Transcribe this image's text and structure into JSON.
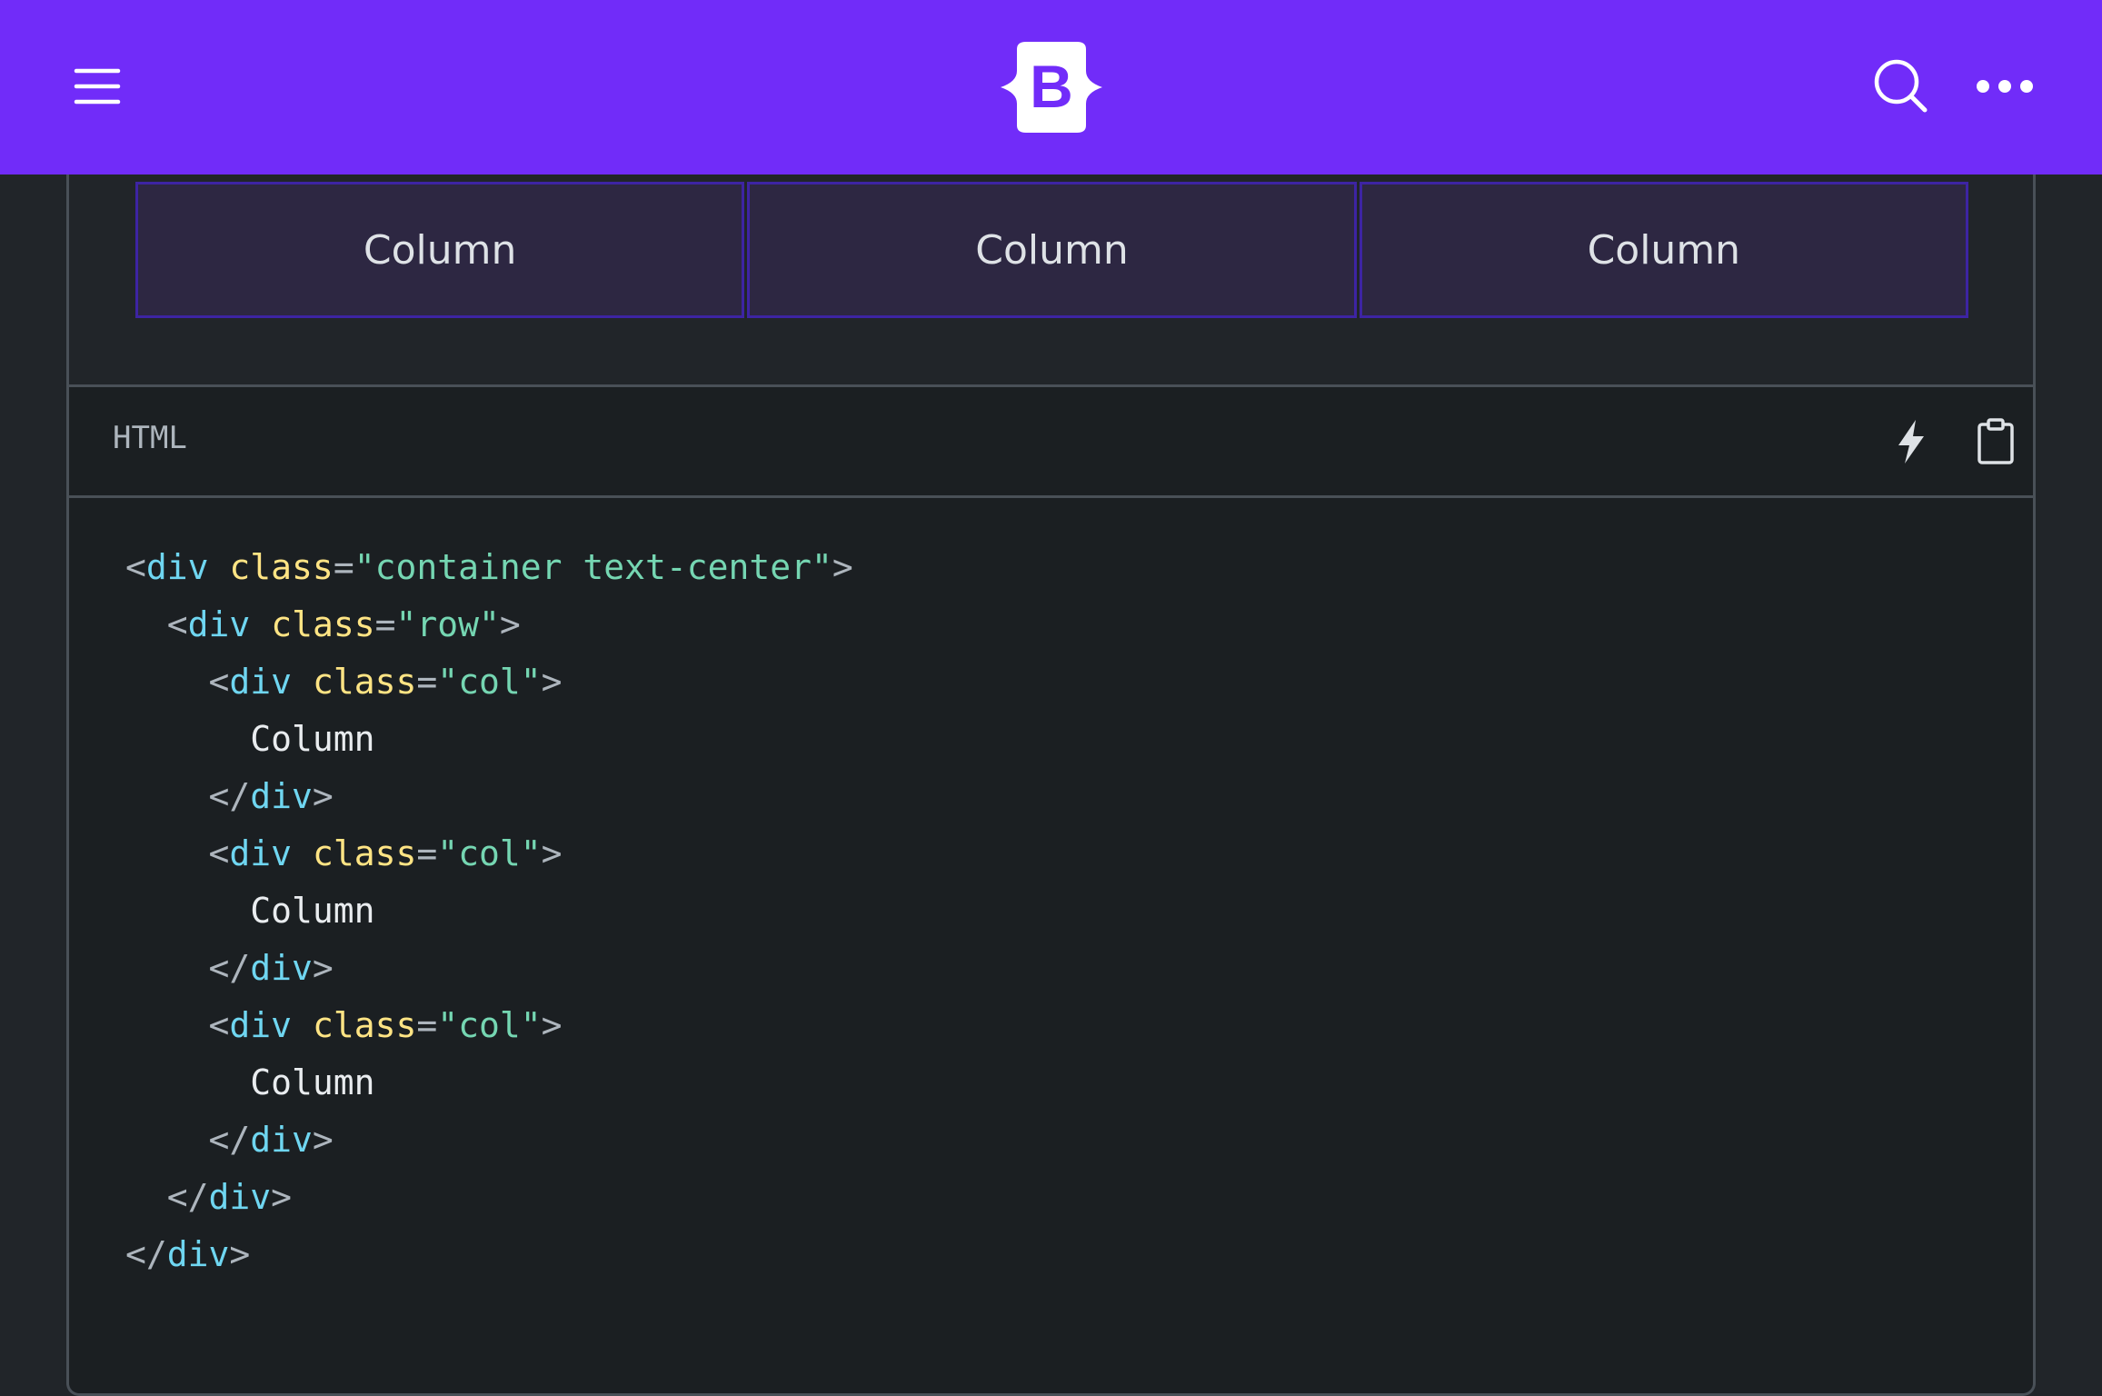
{
  "navbar": {
    "brand_letter": "B",
    "colors": {
      "background": "#712cf9",
      "brand_fg": "#712cf9"
    },
    "icons": [
      "hamburger-menu-icon",
      "bootstrap-logo-icon",
      "search-icon",
      "more-horizontal-icon"
    ]
  },
  "preview": {
    "columns": [
      "Column",
      "Column",
      "Column"
    ],
    "colors": {
      "col_bg": "#2d2742",
      "col_border": "#3d24a3"
    }
  },
  "code_header": {
    "language": "HTML",
    "icons": [
      "lightning-icon",
      "clipboard-icon"
    ]
  },
  "code": {
    "lines": [
      {
        "indent": "",
        "kind": "open",
        "tag": "div",
        "attr": "class",
        "value": "container text-center"
      },
      {
        "indent": "  ",
        "kind": "open",
        "tag": "div",
        "attr": "class",
        "value": "row"
      },
      {
        "indent": "    ",
        "kind": "open",
        "tag": "div",
        "attr": "class",
        "value": "col"
      },
      {
        "indent": "      ",
        "kind": "text",
        "text": "Column"
      },
      {
        "indent": "    ",
        "kind": "close",
        "tag": "div"
      },
      {
        "indent": "    ",
        "kind": "open",
        "tag": "div",
        "attr": "class",
        "value": "col"
      },
      {
        "indent": "      ",
        "kind": "text",
        "text": "Column"
      },
      {
        "indent": "    ",
        "kind": "close",
        "tag": "div"
      },
      {
        "indent": "    ",
        "kind": "open",
        "tag": "div",
        "attr": "class",
        "value": "col"
      },
      {
        "indent": "      ",
        "kind": "text",
        "text": "Column"
      },
      {
        "indent": "    ",
        "kind": "close",
        "tag": "div"
      },
      {
        "indent": "  ",
        "kind": "close",
        "tag": "div"
      },
      {
        "indent": "",
        "kind": "close",
        "tag": "div"
      }
    ],
    "colors": {
      "tag": "#6fd6f1",
      "attr": "#ffe484",
      "string": "#75d6b2",
      "punct": "#adb5bd"
    }
  }
}
